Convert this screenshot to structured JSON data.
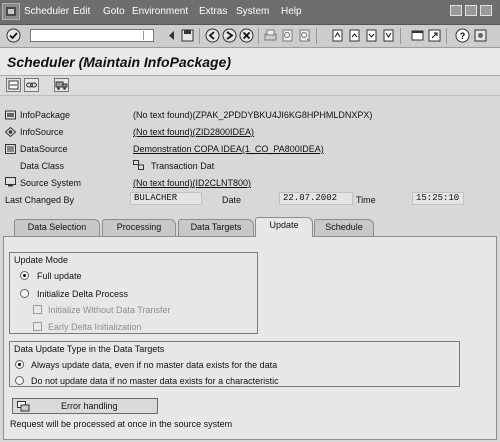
{
  "menubar": {
    "items": [
      "Scheduler",
      "Edit",
      "Goto",
      "Environment",
      "Extras",
      "System",
      "Help"
    ]
  },
  "toolbar": {
    "icons": [
      "enter-icon",
      "back-icon",
      "exit-icon",
      "cancel-icon",
      "print-icon",
      "find-icon",
      "find-next-icon",
      "first-page-icon",
      "prev-page-icon",
      "next-page-icon",
      "last-page-icon",
      "create-session-icon",
      "shortcut-icon",
      "layout-icon",
      "help-icon",
      "customize-icon"
    ]
  },
  "title": "Scheduler (Maintain InfoPackage)",
  "header": {
    "infopackage_label": "InfoPackage",
    "infopackage_value": "(No text found)(ZPAK_2PDDYBKU4JI6KG8HPHMLDNXPX)",
    "infosource_label": "InfoSource",
    "infosource_value": "(No text found)(ZID2800IDEA)",
    "datasource_label": "DataSource",
    "datasource_value": "Demonstration COPA IDEA(1_CO_PA800IDEA)",
    "dataclass_label": "Data Class",
    "dataclass_value": "Transaction Dat",
    "sourcesystem_label": "Source System",
    "sourcesystem_value": "(No text found)(ID2CLNT800)",
    "lastchanged_label": "Last Changed By",
    "lastchanged_value": "BULACHER",
    "date_label": "Date",
    "date_value": "22.07.2002",
    "time_label": "Time",
    "time_value": "15:25:10"
  },
  "tabs": [
    {
      "label": "Data Selection"
    },
    {
      "label": "Processing"
    },
    {
      "label": "Data Targets"
    },
    {
      "label": "Update"
    },
    {
      "label": "Schedule"
    }
  ],
  "active_tab": "Update",
  "update_mode": {
    "title": "Update Mode",
    "full_update": "Full update",
    "init_delta": "Initialize Delta Process",
    "init_without_transfer": "Initialize Without Data Transfer",
    "early_delta": "Early Delta Initialization",
    "selected": "Full update"
  },
  "update_type": {
    "title": "Data Update Type in the Data Targets",
    "always": "Always update data, even if no master data exists for the data",
    "do_not": "Do not update data if no master data exists for a characteristic",
    "selected": "Always update data, even if no master data exists for the data"
  },
  "error_button": "Error handling",
  "footer_text": "Request will be processed at once in the source system"
}
